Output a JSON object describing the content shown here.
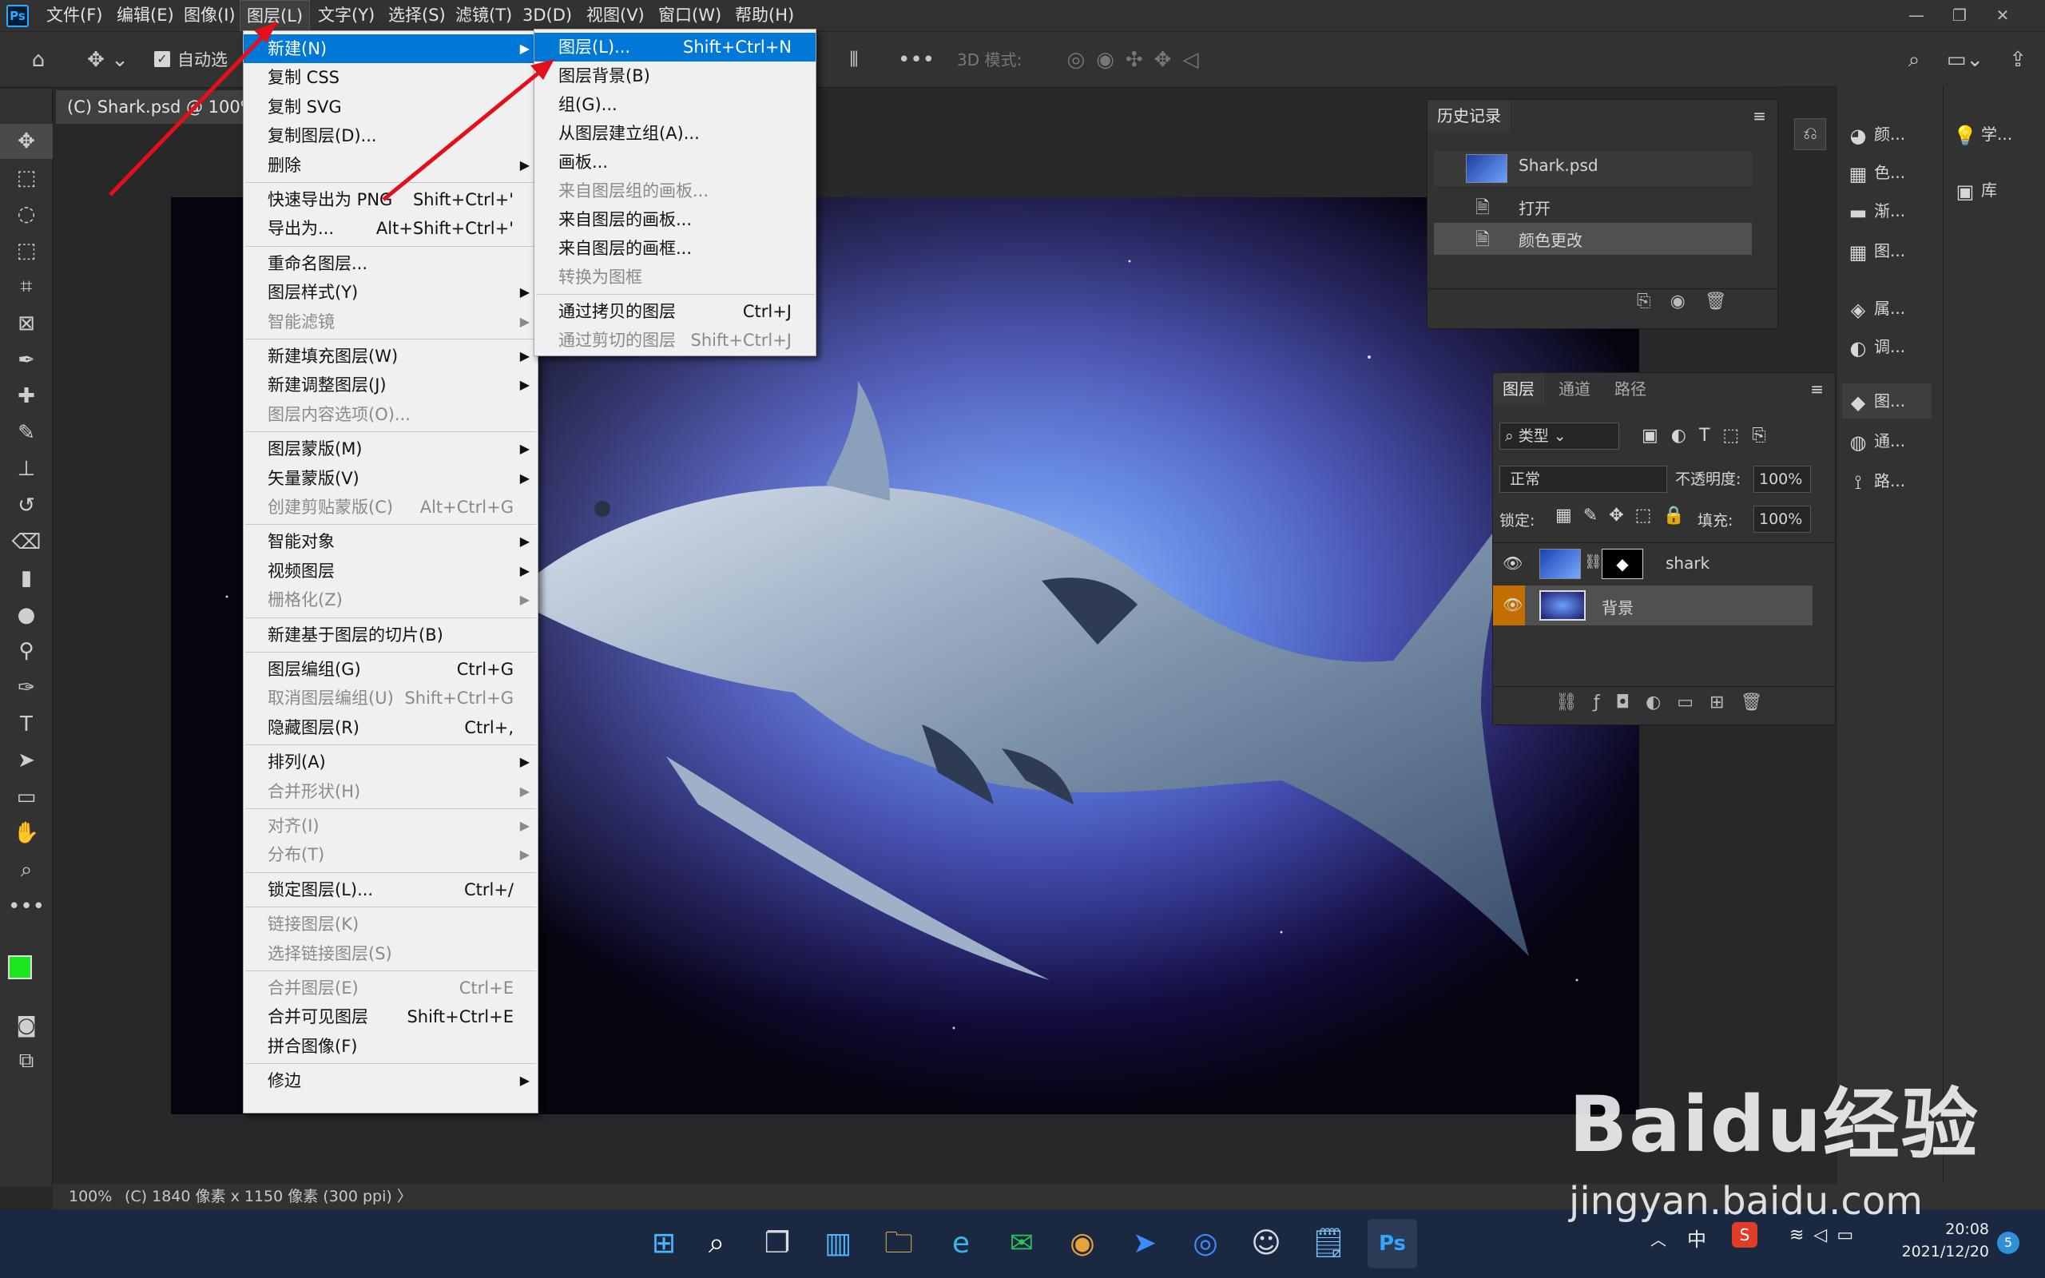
{
  "app": {
    "logo": "Ps",
    "win_buttons": [
      "—",
      "❐",
      "✕"
    ]
  },
  "menubar": [
    "文件(F)",
    "编辑(E)",
    "图像(I)",
    "图层(L)",
    "文字(Y)",
    "选择(S)",
    "滤镜(T)",
    "3D(D)",
    "视图(V)",
    "窗口(W)",
    "帮助(H)"
  ],
  "options": {
    "auto_select": "自动选",
    "mode3d": "3D 模式:"
  },
  "document": {
    "tab": "(C) Shark.psd @ 100% ("
  },
  "status": {
    "zoom": "100%",
    "info": "(C) 1840 像素 x 1150 像素 (300 ppi)  〉"
  },
  "layer_menu": [
    {
      "l": "新建(N)",
      "sub": true,
      "hl": true
    },
    {
      "l": "复制 CSS"
    },
    {
      "l": "复制 SVG"
    },
    {
      "l": "复制图层(D)..."
    },
    {
      "l": "删除",
      "sub": true
    },
    {
      "sep": true
    },
    {
      "l": "快速导出为 PNG",
      "s": "Shift+Ctrl+'"
    },
    {
      "l": "导出为...",
      "s": "Alt+Shift+Ctrl+'"
    },
    {
      "sep": true
    },
    {
      "l": "重命名图层..."
    },
    {
      "l": "图层样式(Y)",
      "sub": true
    },
    {
      "l": "智能滤镜",
      "sub": true,
      "dis": true
    },
    {
      "sep": true
    },
    {
      "l": "新建填充图层(W)",
      "sub": true
    },
    {
      "l": "新建调整图层(J)",
      "sub": true
    },
    {
      "l": "图层内容选项(O)...",
      "dis": true
    },
    {
      "sep": true
    },
    {
      "l": "图层蒙版(M)",
      "sub": true
    },
    {
      "l": "矢量蒙版(V)",
      "sub": true
    },
    {
      "l": "创建剪贴蒙版(C)",
      "s": "Alt+Ctrl+G",
      "dis": true
    },
    {
      "sep": true
    },
    {
      "l": "智能对象",
      "sub": true
    },
    {
      "l": "视频图层",
      "sub": true
    },
    {
      "l": "栅格化(Z)",
      "sub": true,
      "dis": true
    },
    {
      "sep": true
    },
    {
      "l": "新建基于图层的切片(B)"
    },
    {
      "sep": true
    },
    {
      "l": "图层编组(G)",
      "s": "Ctrl+G"
    },
    {
      "l": "取消图层编组(U)",
      "s": "Shift+Ctrl+G",
      "dis": true
    },
    {
      "l": "隐藏图层(R)",
      "s": "Ctrl+,"
    },
    {
      "sep": true
    },
    {
      "l": "排列(A)",
      "sub": true
    },
    {
      "l": "合并形状(H)",
      "sub": true,
      "dis": true
    },
    {
      "sep": true
    },
    {
      "l": "对齐(I)",
      "sub": true,
      "dis": true
    },
    {
      "l": "分布(T)",
      "sub": true,
      "dis": true
    },
    {
      "sep": true
    },
    {
      "l": "锁定图层(L)...",
      "s": "Ctrl+/"
    },
    {
      "sep": true
    },
    {
      "l": "链接图层(K)",
      "dis": true
    },
    {
      "l": "选择链接图层(S)",
      "dis": true
    },
    {
      "sep": true
    },
    {
      "l": "合并图层(E)",
      "s": "Ctrl+E",
      "dis": true
    },
    {
      "l": "合并可见图层",
      "s": "Shift+Ctrl+E"
    },
    {
      "l": "拼合图像(F)"
    },
    {
      "sep": true
    },
    {
      "l": "修边",
      "sub": true
    }
  ],
  "new_submenu": [
    {
      "l": "图层(L)...",
      "s": "Shift+Ctrl+N",
      "hl": true
    },
    {
      "l": "图层背景(B)"
    },
    {
      "l": "组(G)..."
    },
    {
      "l": "从图层建立组(A)..."
    },
    {
      "l": "画板..."
    },
    {
      "l": "来自图层组的画板...",
      "dis": true
    },
    {
      "l": "来自图层的画板..."
    },
    {
      "l": "来自图层的画框..."
    },
    {
      "l": "转换为图框",
      "dis": true
    },
    {
      "sep": true
    },
    {
      "l": "通过拷贝的图层",
      "s": "Ctrl+J"
    },
    {
      "l": "通过剪切的图层",
      "s": "Shift+Ctrl+J",
      "dis": true
    }
  ],
  "history": {
    "title": "历史记录",
    "snapshot": "Shark.psd",
    "items": [
      "打开",
      "颜色更改"
    ]
  },
  "layers": {
    "tabs": [
      "图层",
      "通道",
      "路径"
    ],
    "filter": "类型",
    "blend": "正常",
    "opacity_label": "不透明度:",
    "opacity": "100%",
    "lock_label": "锁定:",
    "fill_label": "填充:",
    "fill": "100%",
    "items": [
      "shark",
      "背景"
    ]
  },
  "dock_a": [
    "颜...",
    "色...",
    "渐...",
    "图...",
    "属...",
    "调...",
    "图...",
    "通...",
    "路..."
  ],
  "dock_b": [
    "学...",
    "库"
  ],
  "taskbar": {
    "time": "20:08",
    "date": "2021/12/20",
    "ime": "中",
    "badge": "5"
  },
  "watermark": {
    "brand": "Baidu经验",
    "url": "jingyan.baidu.com"
  }
}
